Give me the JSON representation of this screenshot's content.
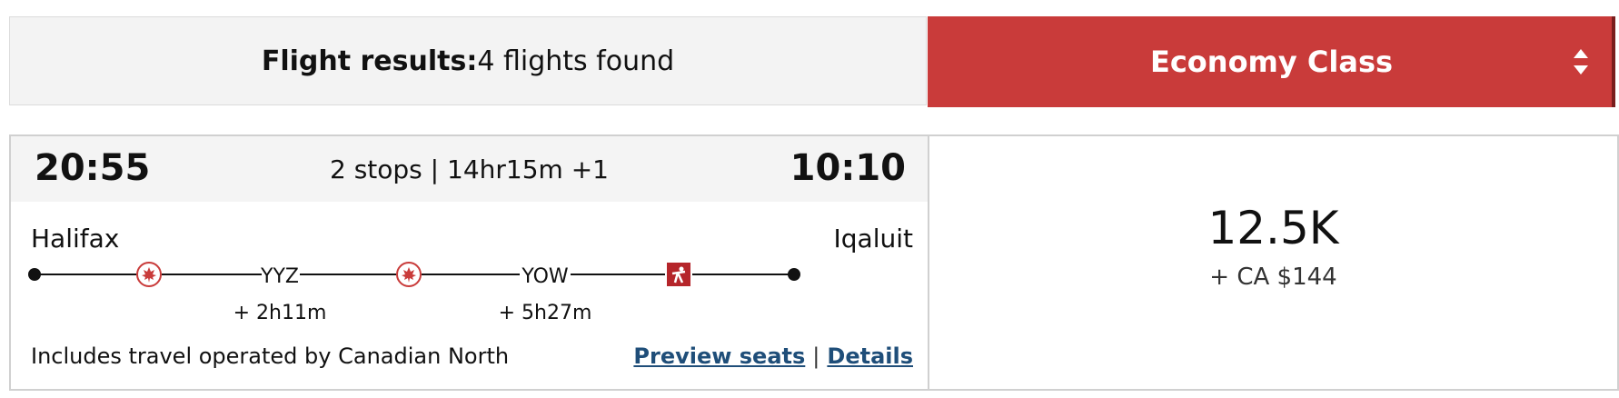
{
  "header": {
    "results_label": "Flight results:",
    "results_count": "4 flights found"
  },
  "cabin_selector": {
    "selected": "Economy Class",
    "accent_color": "#c93b3a"
  },
  "flight": {
    "departure_time": "20:55",
    "arrival_time": "10:10",
    "stops_summary": "2 stops | 14hr15m +1",
    "origin": "Halifax",
    "destination": "Iqaluit",
    "stops": [
      {
        "code": "YYZ",
        "layover": "+ 2h11m"
      },
      {
        "code": "YOW",
        "layover": "+ 5h27m"
      }
    ],
    "segment_icons": [
      "air-canada-maple-leaf-icon",
      "air-canada-maple-leaf-icon",
      "canadian-north-icon"
    ],
    "operated_note": "Includes travel operated by Canadian North",
    "preview_seats_label": "Preview seats",
    "link_separator": "|",
    "details_label": "Details"
  },
  "fare": {
    "points": "12.5K",
    "cash": "+ CA $144"
  }
}
